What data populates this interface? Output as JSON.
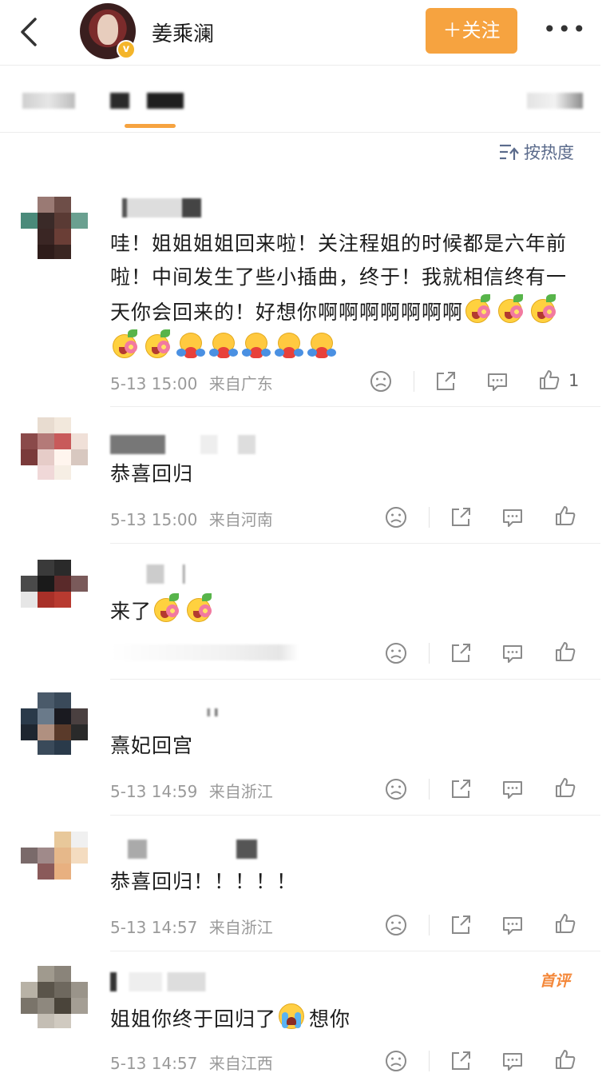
{
  "header": {
    "username": "姜乘澜",
    "follow_label": "＋关注",
    "more_label": "•••"
  },
  "sort": {
    "label": "按热度"
  },
  "comments": [
    {
      "text": "哇！姐姐姐姐回来啦！关注程姐的时候都是六年前啦！中间发生了些小插曲，终于！我就相信终有一天你会回来的！好想你啊啊啊啊啊啊啊",
      "emojis": [
        "flower",
        "flower",
        "flower",
        "flower",
        "flower",
        "hug",
        "hug",
        "hug",
        "hug",
        "hug"
      ],
      "time": "5-13 15:00",
      "location": "来自广东",
      "likes": "1"
    },
    {
      "text": "恭喜回归",
      "time": "5-13 15:00",
      "location": "来自河南"
    },
    {
      "text": "来了",
      "emojis": [
        "flower",
        "flower"
      ],
      "time": "",
      "location": ""
    },
    {
      "text": "熹妃回宫",
      "time": "5-13 14:59",
      "location": "来自浙江"
    },
    {
      "text": "恭喜回归！！！！！",
      "time": "5-13 14:57",
      "location": "来自浙江"
    },
    {
      "text": "姐姐你终于回归了",
      "text_after": "想你",
      "time": "5-13 14:57",
      "location": "来自江西",
      "badge": "首评"
    }
  ],
  "icons": [
    "back-icon",
    "verified-icon",
    "sort-icon",
    "dislike-icon",
    "share-icon",
    "comment-icon",
    "like-icon"
  ],
  "colors": {
    "accent": "#f6a340",
    "meta": "#9a9a9a",
    "sort": "#5b6b8c"
  }
}
